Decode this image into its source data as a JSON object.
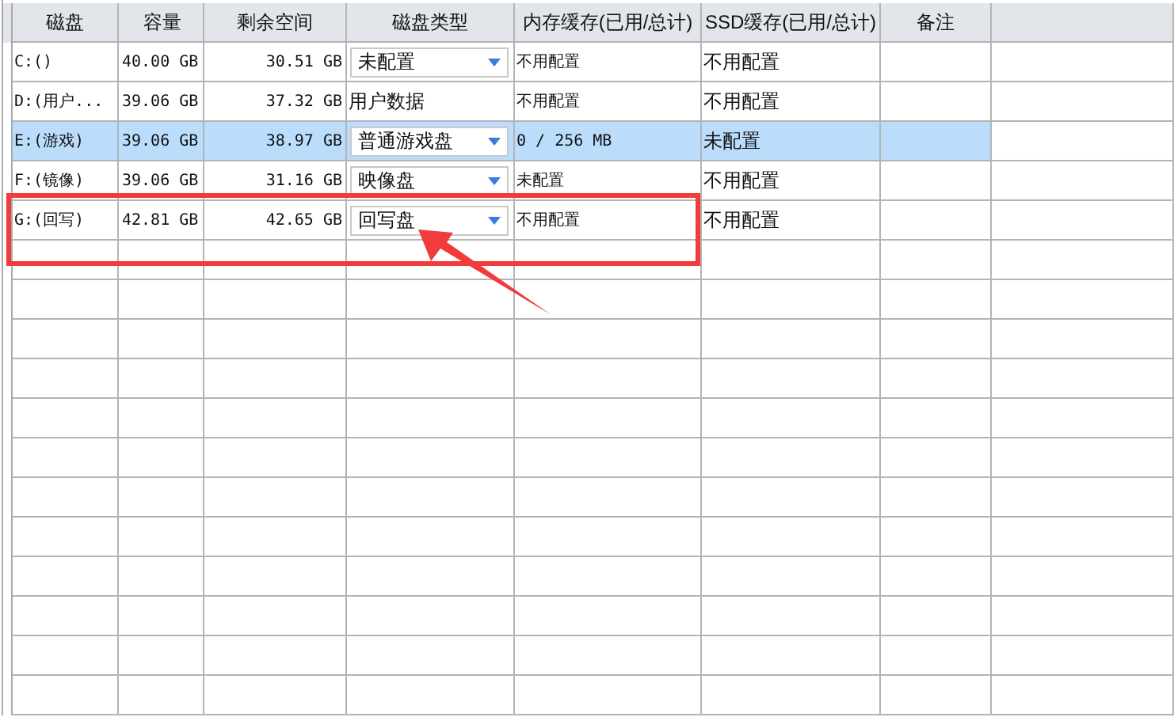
{
  "table": {
    "columns": [
      "磁盘",
      "容量",
      "剩余空间",
      "磁盘类型",
      "内存缓存(已用/总计)",
      "SSD缓存(已用/总计)",
      "备注"
    ],
    "rows": [
      {
        "disk": "C:()",
        "capacity": "40.00 GB",
        "free": "30.51 GB",
        "type": {
          "kind": "dropdown",
          "value": "未配置"
        },
        "memory_cache": "不用配置",
        "ssd_cache": "不用配置",
        "selected": false
      },
      {
        "disk": "D:(用户...",
        "capacity": "39.06 GB",
        "free": "37.32 GB",
        "type": {
          "kind": "text",
          "value": "用户数据"
        },
        "memory_cache": "不用配置",
        "ssd_cache": "不用配置",
        "selected": false
      },
      {
        "disk": "E:(游戏)",
        "capacity": "39.06 GB",
        "free": "38.97 GB",
        "type": {
          "kind": "dropdown",
          "value": "普通游戏盘"
        },
        "memory_cache": "0 / 256 MB",
        "ssd_cache": "未配置",
        "selected": true
      },
      {
        "disk": "F:(镜像)",
        "capacity": "39.06 GB",
        "free": "31.16 GB",
        "type": {
          "kind": "dropdown",
          "value": "映像盘"
        },
        "memory_cache": "未配置",
        "ssd_cache": "不用配置",
        "selected": false
      },
      {
        "disk": "G:(回写)",
        "capacity": "42.81 GB",
        "free": "42.65 GB",
        "type": {
          "kind": "dropdown",
          "value": "回写盘"
        },
        "memory_cache": "不用配置",
        "ssd_cache": "不用配置",
        "selected": false
      }
    ]
  }
}
